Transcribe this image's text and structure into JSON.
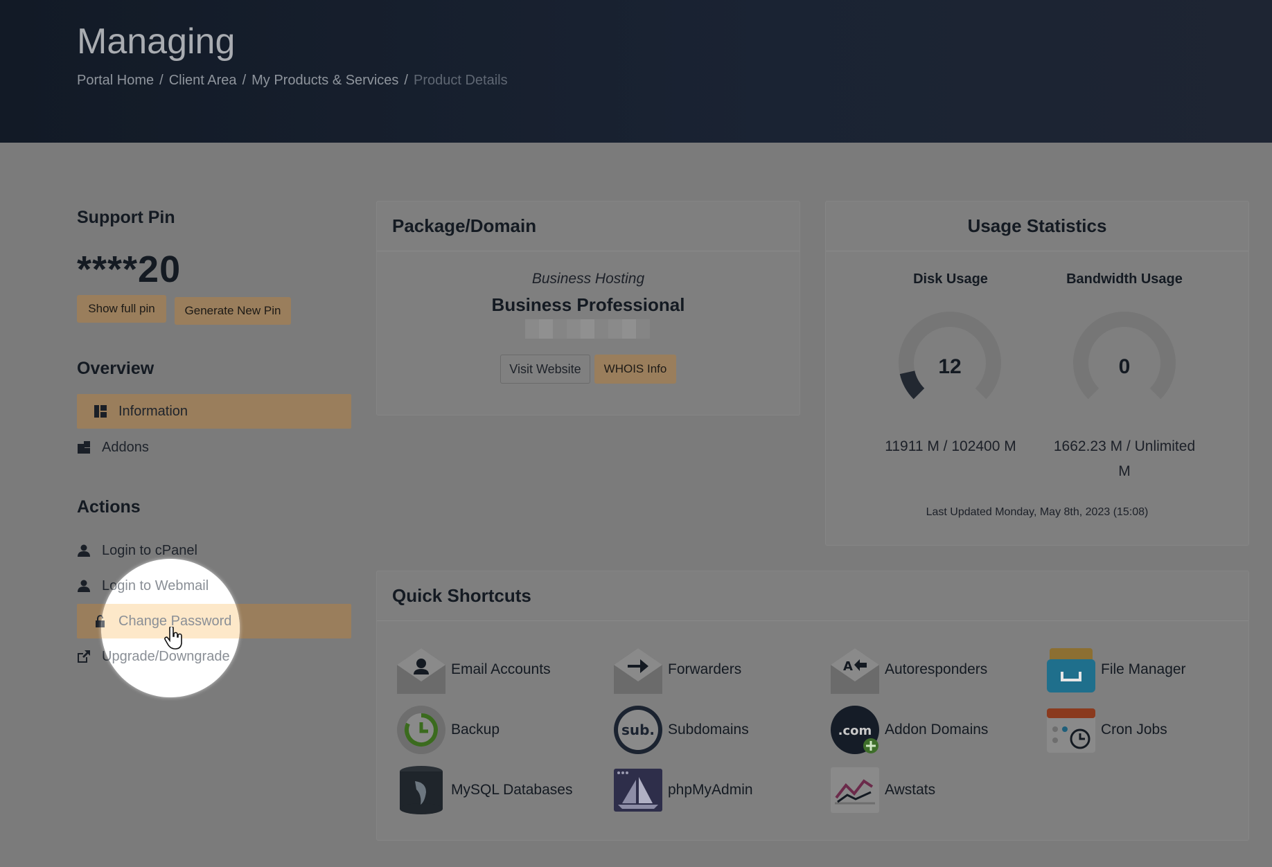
{
  "header": {
    "title": "Managing",
    "breadcrumb": [
      "Portal Home",
      "Client Area",
      "My Products & Services",
      "Product Details"
    ]
  },
  "sidebar": {
    "support_pin_title": "Support Pin",
    "pin_value": "****20",
    "show_full_pin": "Show full pin",
    "generate_new_pin": "Generate New Pin",
    "overview_title": "Overview",
    "overview_items": [
      {
        "label": "Information",
        "icon": "dashboard-icon",
        "active": true
      },
      {
        "label": "Addons",
        "icon": "cubes-icon",
        "active": false
      }
    ],
    "actions_title": "Actions",
    "action_items": [
      {
        "label": "Login to cPanel",
        "icon": "user-icon"
      },
      {
        "label": "Login to Webmail",
        "icon": "user-icon"
      },
      {
        "label": "Change Password",
        "icon": "lock-icon",
        "active": true
      },
      {
        "label": "Upgrade/Downgrade",
        "icon": "external-link-icon"
      }
    ]
  },
  "package": {
    "title": "Package/Domain",
    "group": "Business Hosting",
    "name": "Business Professional",
    "visit_website": "Visit Website",
    "whois_info": "WHOIS Info"
  },
  "usage": {
    "title": "Usage Statistics",
    "disk_label": "Disk Usage",
    "disk_percent": 12,
    "disk_value": "11911 M / 102400 M",
    "bandwidth_label": "Bandwidth Usage",
    "bandwidth_percent": 0,
    "bandwidth_value_line1": "1662.23 M / Unlimited",
    "bandwidth_value_line2": "M",
    "last_updated": "Last Updated Monday, May 8th, 2023 (15:08)"
  },
  "shortcuts": {
    "title": "Quick Shortcuts",
    "items": [
      {
        "label": "Email Accounts",
        "icon": "email-accounts-icon"
      },
      {
        "label": "Forwarders",
        "icon": "forwarders-icon"
      },
      {
        "label": "Autoresponders",
        "icon": "autoresponders-icon"
      },
      {
        "label": "File Manager",
        "icon": "file-manager-icon"
      },
      {
        "label": "Backup",
        "icon": "backup-icon"
      },
      {
        "label": "Subdomains",
        "icon": "subdomains-icon"
      },
      {
        "label": "Addon Domains",
        "icon": "addon-domains-icon"
      },
      {
        "label": "Cron Jobs",
        "icon": "cron-jobs-icon"
      },
      {
        "label": "MySQL Databases",
        "icon": "mysql-databases-icon"
      },
      {
        "label": "phpMyAdmin",
        "icon": "phpmyadmin-icon"
      },
      {
        "label": "Awstats",
        "icon": "awstats-icon"
      }
    ]
  },
  "colors": {
    "accent": "#9a7e5c",
    "highlight": "#fde8c9",
    "header_bg": "#121a26"
  }
}
